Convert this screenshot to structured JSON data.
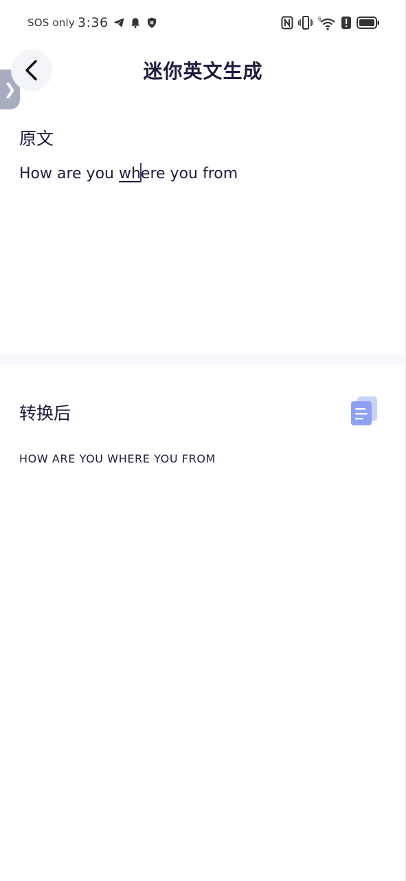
{
  "status_bar": {
    "carrier": "SOS only",
    "time": "3:36",
    "icons": [
      "telegram-icon",
      "bell-icon",
      "shield-icon",
      "nfc-icon",
      "vibrate-icon",
      "wifi-icon",
      "alert-icon",
      "battery-icon"
    ],
    "wifi_badge": "6"
  },
  "side_tab": {
    "glyph": "❯"
  },
  "header": {
    "title": "迷你英文生成"
  },
  "source": {
    "label": "原文",
    "text_before": "How are you ",
    "composing": "wh",
    "text_after": "ere you from"
  },
  "result": {
    "label": "转换后",
    "text": "HOW ARE YOU WHERE YOU FROM"
  },
  "colors": {
    "title": "#1d1c3c",
    "accent": "#8ea1f5",
    "accent_light": "#c9d2fb",
    "divider": "#f7f8fc"
  }
}
